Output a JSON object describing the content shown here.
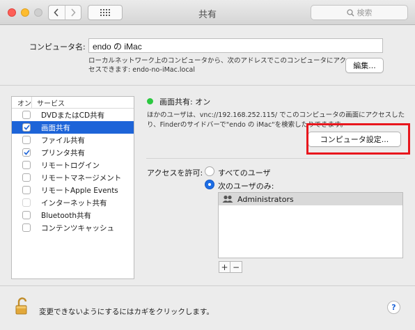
{
  "window": {
    "title": "共有"
  },
  "toolbar": {
    "search_placeholder": "検索",
    "back_icon": "chevron-left-icon",
    "forward_icon": "chevron-right-icon",
    "grid_icon": "grid-icon"
  },
  "computer_name": {
    "label": "コンピュータ名:",
    "value": "endo の iMac",
    "info_line1": "ローカルネットワーク上のコンピュータから、次のアドレスでこのコンピュータにアク",
    "info_line2": "セスできます: endo-no-iMac.local",
    "edit_button": "編集..."
  },
  "services": {
    "header_on": "オン",
    "header_service": "サービス",
    "items": [
      {
        "label": "DVDまたはCD共有",
        "checked": false,
        "selected": false
      },
      {
        "label": "画面共有",
        "checked": true,
        "selected": true
      },
      {
        "label": "ファイル共有",
        "checked": false,
        "selected": false
      },
      {
        "label": "プリンタ共有",
        "checked": true,
        "selected": false
      },
      {
        "label": "リモートログイン",
        "checked": false,
        "selected": false
      },
      {
        "label": "リモートマネージメント",
        "checked": false,
        "selected": false
      },
      {
        "label": "リモートApple Events",
        "checked": false,
        "selected": false
      },
      {
        "label": "インターネット共有",
        "checked": false,
        "selected": false,
        "dimmed": true
      },
      {
        "label": "Bluetooth共有",
        "checked": false,
        "selected": false
      },
      {
        "label": "コンテンツキャッシュ",
        "checked": false,
        "selected": false
      }
    ]
  },
  "detail": {
    "status": "画面共有: オン",
    "status_color": "#2bc840",
    "desc_line1": "ほかのユーザは、vnc://192.168.252.115/ でこのコンピュータの画面にアクセスした",
    "desc_line2": "り、Finderのサイドバーで\"endo の iMac\"を検索したりできます。",
    "computer_settings_button": "コンピュータ設定...",
    "access_label": "アクセスを許可:",
    "option_all": "すべてのユーザ",
    "option_only": "次のユーザのみ:",
    "selected_option": "only",
    "users": [
      "Administrators"
    ],
    "add_label": "+",
    "remove_label": "−"
  },
  "footer": {
    "lock_text": "変更できないようにするにはカギをクリックします。",
    "help_label": "?"
  },
  "colors": {
    "highlight": "#e8161d",
    "selection": "#1d64d8"
  }
}
